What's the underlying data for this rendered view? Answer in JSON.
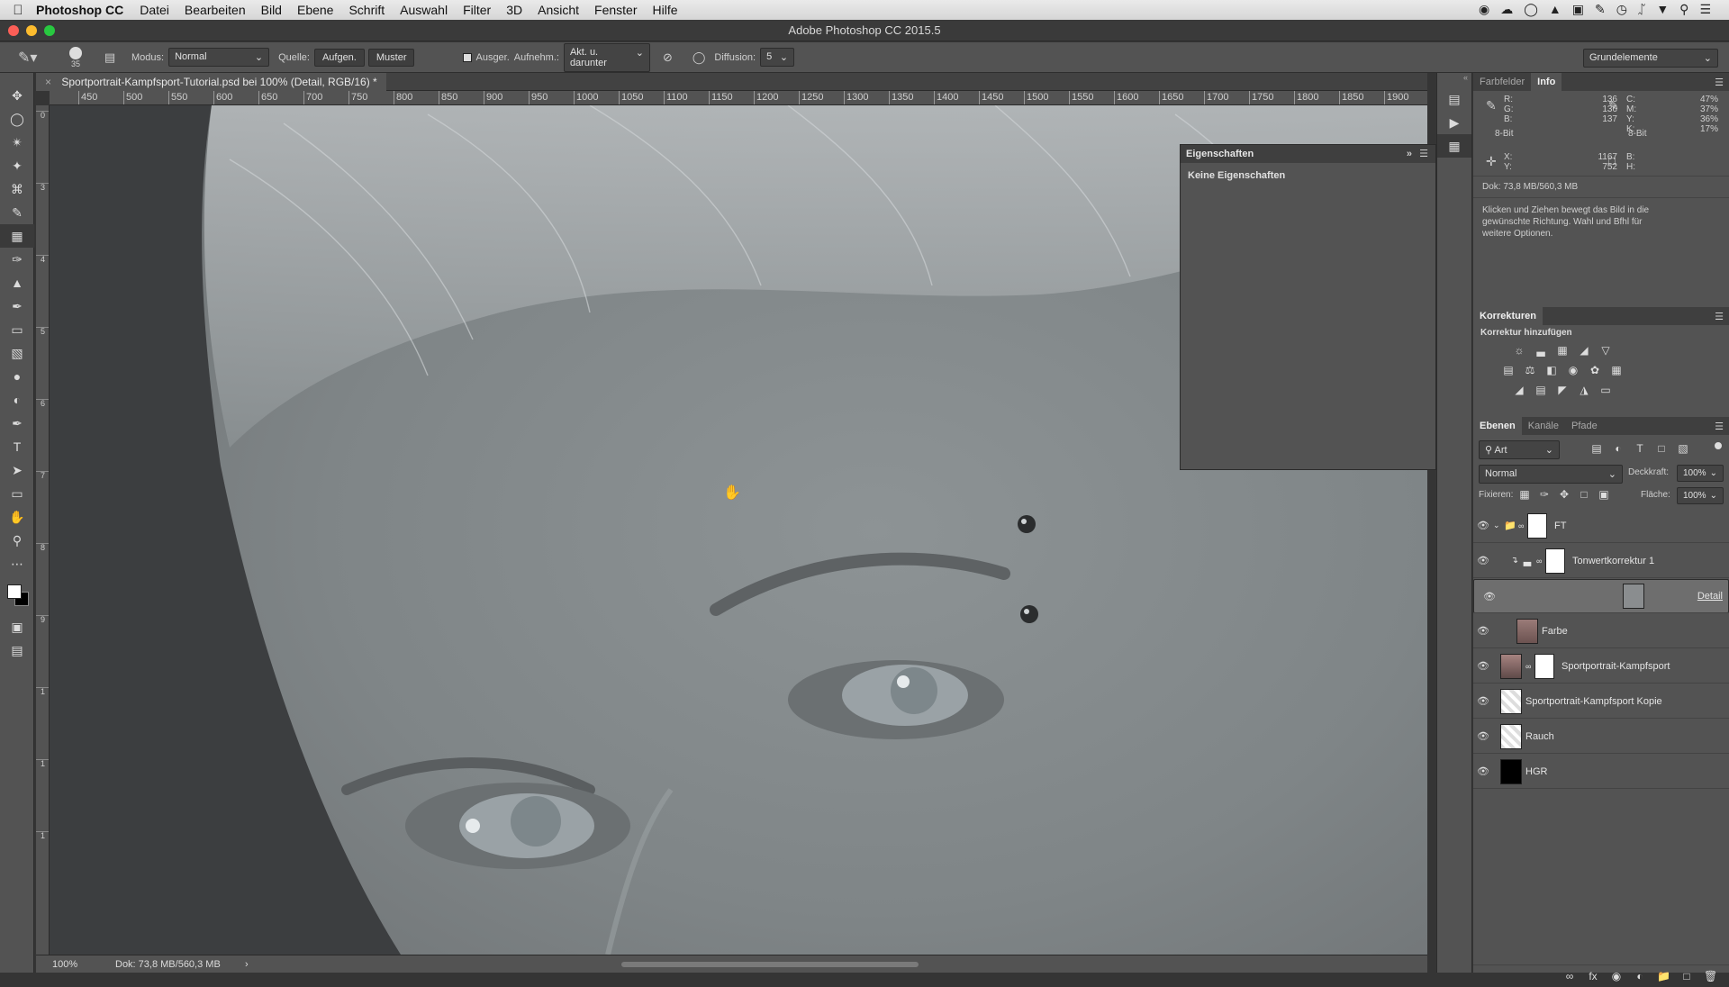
{
  "menubar": {
    "app_name": "Photoshop CC",
    "items": [
      "Datei",
      "Bearbeiten",
      "Bild",
      "Ebene",
      "Schrift",
      "Auswahl",
      "Filter",
      "3D",
      "Ansicht",
      "Fenster",
      "Hilfe"
    ]
  },
  "window": {
    "title": "Adobe Photoshop CC 2015.5"
  },
  "options": {
    "brush_size": "35",
    "modus_label": "Modus:",
    "modus_value": "Normal",
    "quelle_label": "Quelle:",
    "aufgen_label": "Aufgen.",
    "muster_label": "Muster",
    "ausger_label": "Ausger.",
    "aufnehm_label": "Aufnehm.:",
    "aufnehm_value": "Akt. u. darunter",
    "diffusion_label": "Diffusion:",
    "diffusion_value": "5",
    "workspace": "Grundelemente"
  },
  "document": {
    "tab_title": "Sportportrait-Kampfsport-Tutorial.psd bei 100% (Detail, RGB/16) *",
    "zoom": "100%",
    "doc_size": "Dok: 73,8 MB/560,3 MB"
  },
  "rulers": {
    "h_labels": [
      "450",
      "500",
      "550",
      "600",
      "650",
      "700",
      "750",
      "800",
      "850",
      "900",
      "950",
      "1000",
      "1050",
      "1100",
      "1150",
      "1200",
      "1250",
      "1300",
      "1350",
      "1400",
      "1450",
      "1500",
      "1550",
      "1600",
      "1650",
      "1700",
      "1750",
      "1800",
      "1850",
      "1900"
    ],
    "v_labels": [
      "0",
      "3",
      "4",
      "5",
      "6",
      "7",
      "8",
      "9",
      "1",
      "1",
      "1"
    ]
  },
  "properties": {
    "title": "Eigenschaften",
    "empty": "Keine Eigenschaften"
  },
  "info_panel": {
    "tabs": [
      "Farbfelder",
      "Info"
    ],
    "rgb": {
      "r_label": "R:",
      "g_label": "G:",
      "b_label": "B:",
      "r": "136",
      "g": "136",
      "b": "137"
    },
    "cmyk": {
      "c_label": "C:",
      "m_label": "M:",
      "y_label": "Y:",
      "k_label": "K:",
      "c": "47%",
      "m": "37%",
      "y": "36%",
      "k": "17%"
    },
    "bit_left": "8-Bit",
    "bit_right": "8-Bit",
    "pos": {
      "x_label": "X:",
      "y_label": "Y:",
      "x": "1167",
      "y": "752"
    },
    "size": {
      "b_label": "B:",
      "h_label": "H:"
    },
    "doc": "Dok: 73,8 MB/560,3 MB",
    "hint": "Klicken und Ziehen bewegt das Bild in die gewünschte Richtung. Wahl und Bfhl für weitere Optionen."
  },
  "adjustments": {
    "title": "Korrekturen",
    "subtitle": "Korrektur hinzufügen"
  },
  "layers_panel": {
    "tabs": [
      "Ebenen",
      "Kanäle",
      "Pfade"
    ],
    "filter_label": "Art",
    "blend_mode": "Normal",
    "opacity_label": "Deckkraft:",
    "opacity": "100%",
    "lock_label": "Fixieren:",
    "fill_label": "Fläche:",
    "fill": "100%",
    "layers": [
      {
        "name": "FT"
      },
      {
        "name": "Tonwertkorrektur 1"
      },
      {
        "name": "Detail"
      },
      {
        "name": "Farbe"
      },
      {
        "name": "Sportportrait-Kampfsport"
      },
      {
        "name": "Sportportrait-Kampfsport Kopie"
      },
      {
        "name": "Rauch"
      },
      {
        "name": "HGR"
      }
    ]
  },
  "colors": {
    "panel": "#535353",
    "canvas_skin": "#858b8d",
    "selected_layer": "#6e6e6e"
  }
}
